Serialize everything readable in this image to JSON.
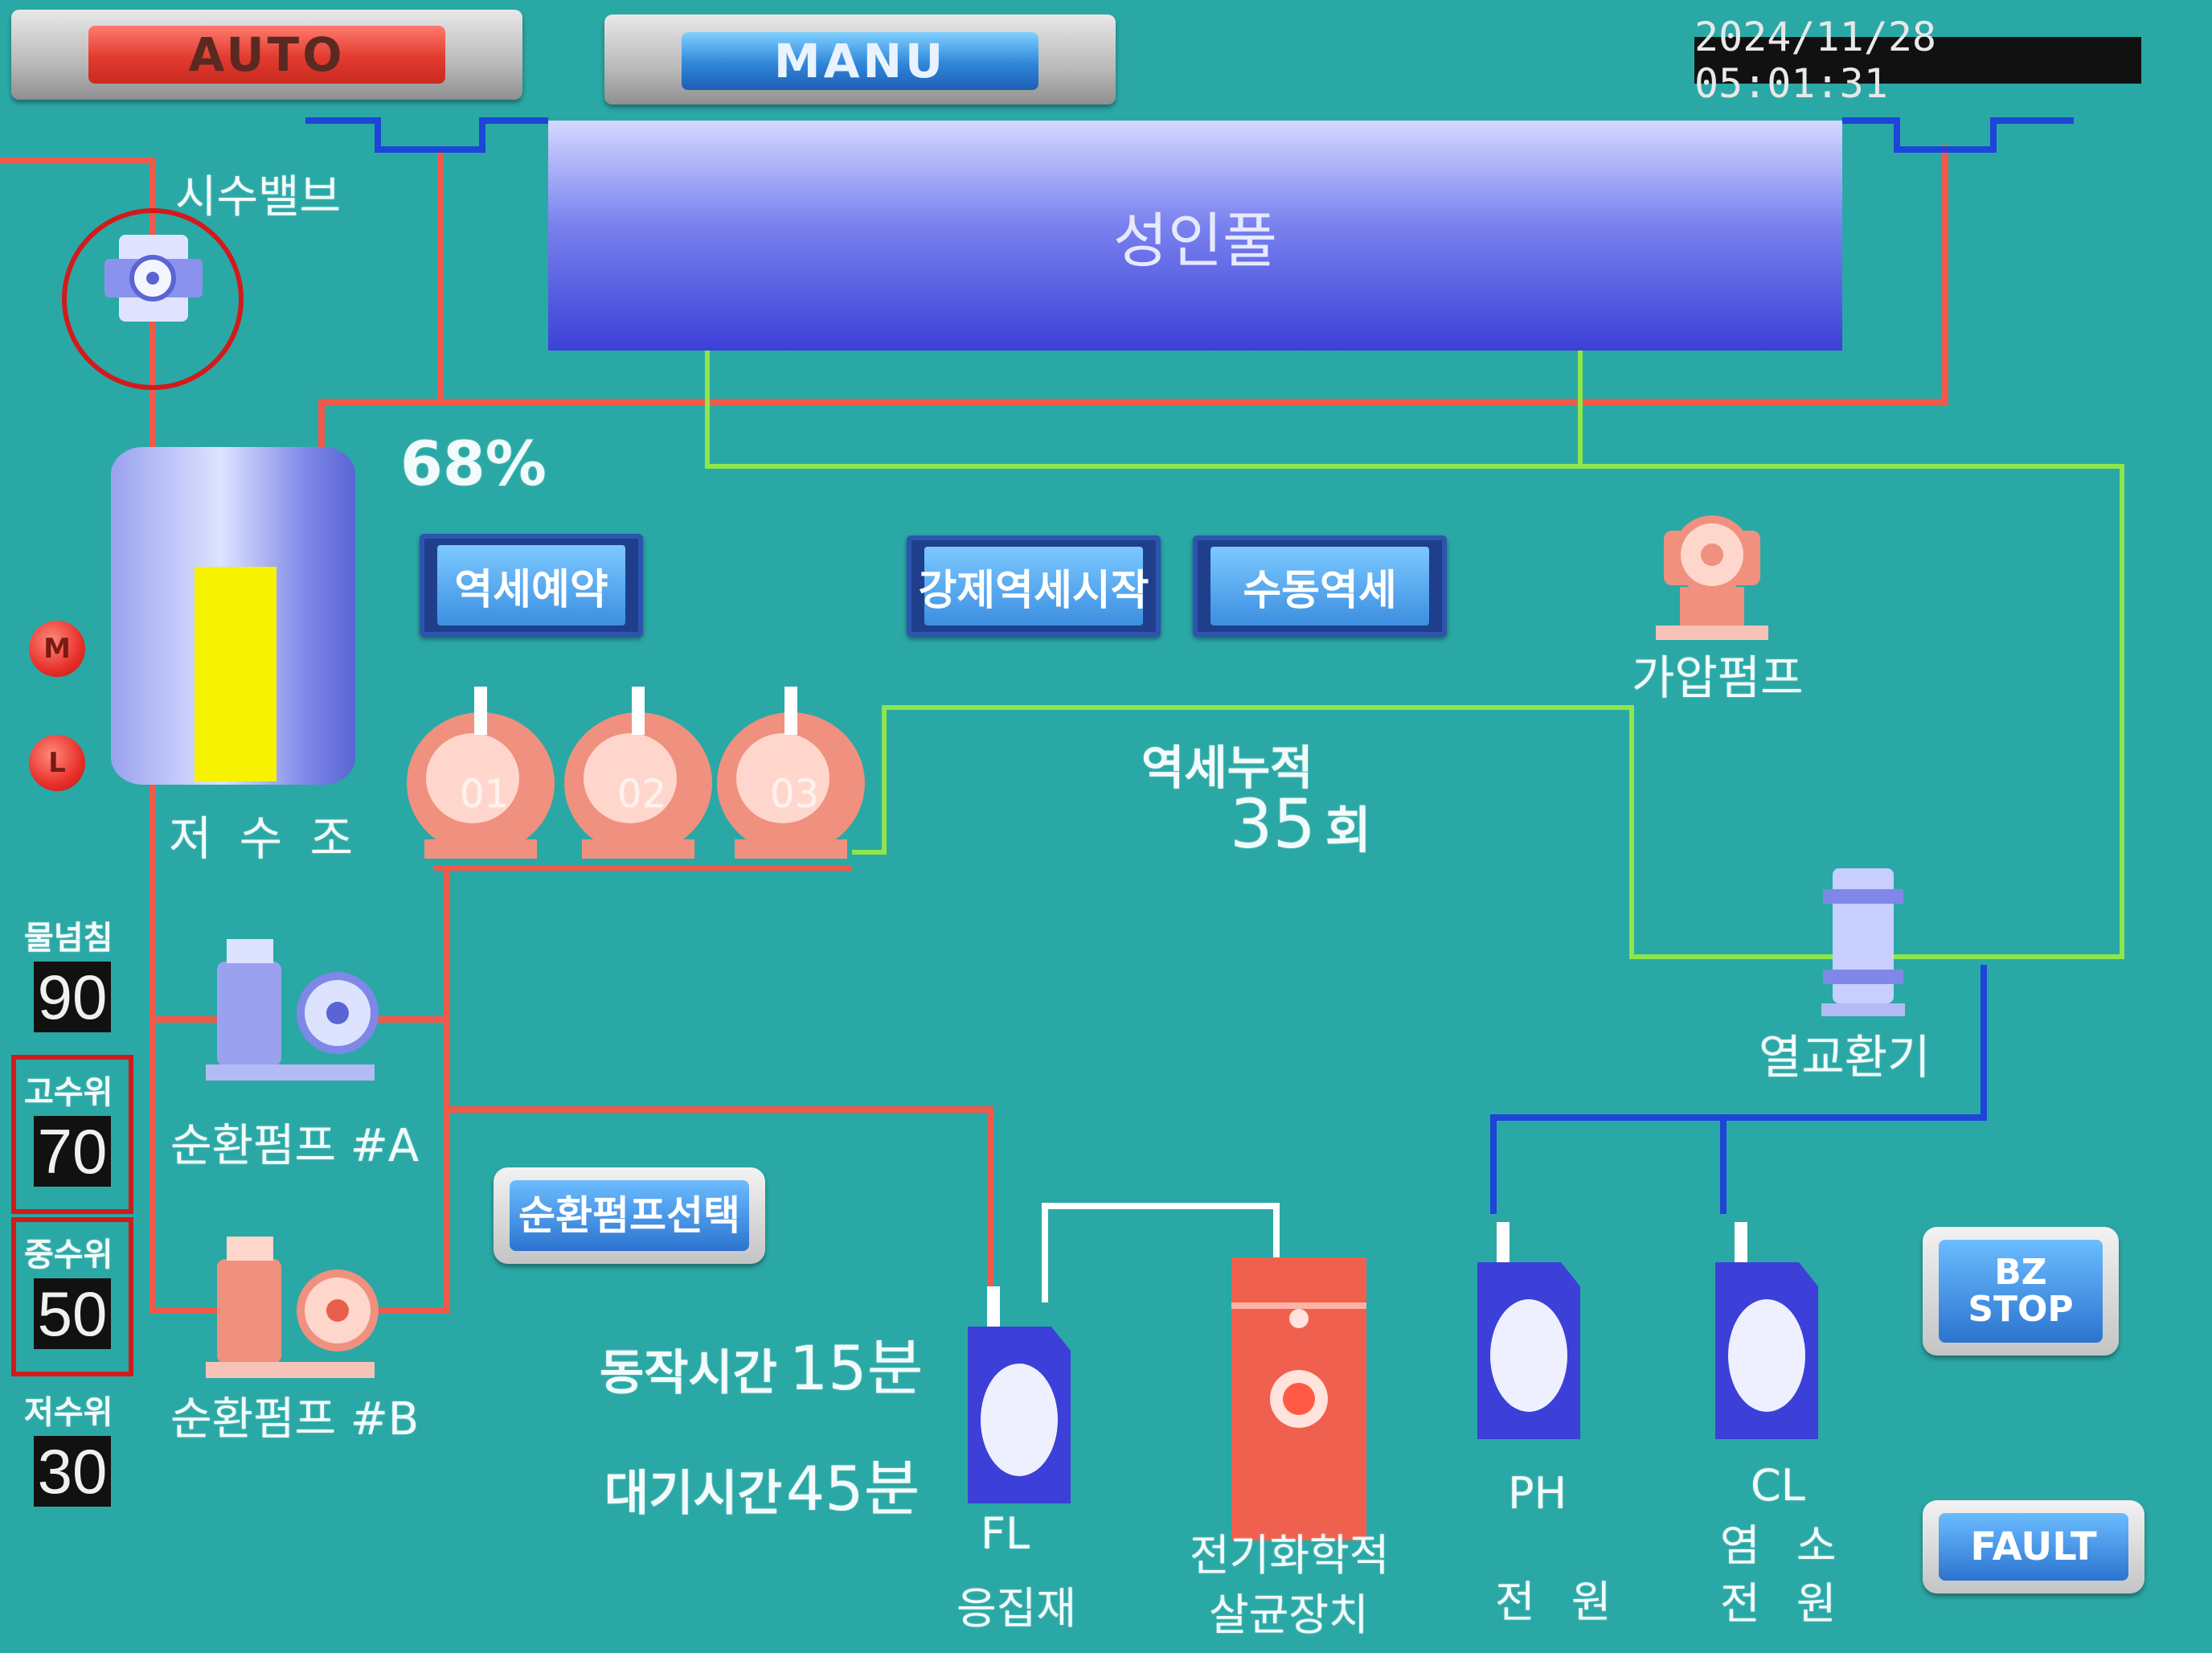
{
  "header": {
    "auto_label": "AUTO",
    "manu_label": "MANU",
    "datetime": "2024/11/28 05:01:31"
  },
  "pool": {
    "label": "성인풀"
  },
  "reservoir": {
    "label": "저 수 조",
    "fill_percent_text": "68%",
    "fill_fraction": 0.68,
    "fill_color": "#f6f200"
  },
  "valve": {
    "label": "시수밸브"
  },
  "indicators": {
    "m_label": "M",
    "l_label": "L"
  },
  "levels": [
    {
      "label": "물넘침",
      "value": "90"
    },
    {
      "label": "고수위",
      "value": "70"
    },
    {
      "label": "중수위",
      "value": "50"
    },
    {
      "label": "저수위",
      "value": "30"
    }
  ],
  "buttons": {
    "backwash_reserve": "역세예약",
    "force_backwash_start": "강제역세시작",
    "manual_backwash": "수동역세",
    "circ_pump_select": "순환펌프선택",
    "bz_stop_line1": "BZ",
    "bz_stop_line2": "STOP",
    "fault": "FAULT"
  },
  "filters": [
    "01",
    "02",
    "03"
  ],
  "backwash_count": {
    "label": "역세누적",
    "value": "35",
    "unit": "회"
  },
  "pumps": {
    "pressure_pump_label": "가압펌프",
    "circ_pump_a_label": "순환펌프 #A",
    "circ_pump_b_label": "순환펌프 #B",
    "heat_exchanger_label": "열교환기"
  },
  "timers": {
    "run_label": "동작시간",
    "run_value": "15분",
    "wait_label": "대기시간",
    "wait_value": "45분"
  },
  "chemicals": [
    {
      "line1": "FL",
      "line2": "응집재"
    },
    {
      "line1": "전기화학적",
      "line2": "살균장치"
    },
    {
      "line1": "PH",
      "line2": "전 원"
    },
    {
      "line1": "CL",
      "line2": "염 소",
      "line3": "전 원"
    }
  ],
  "colors": {
    "background": "#2aa8a6",
    "pipe_red": "#f05a4a",
    "pipe_blue": "#1e44d8",
    "pipe_green": "#8ee64a",
    "pipe_white": "#ffffff",
    "highlight_red": "#d31a1a"
  }
}
